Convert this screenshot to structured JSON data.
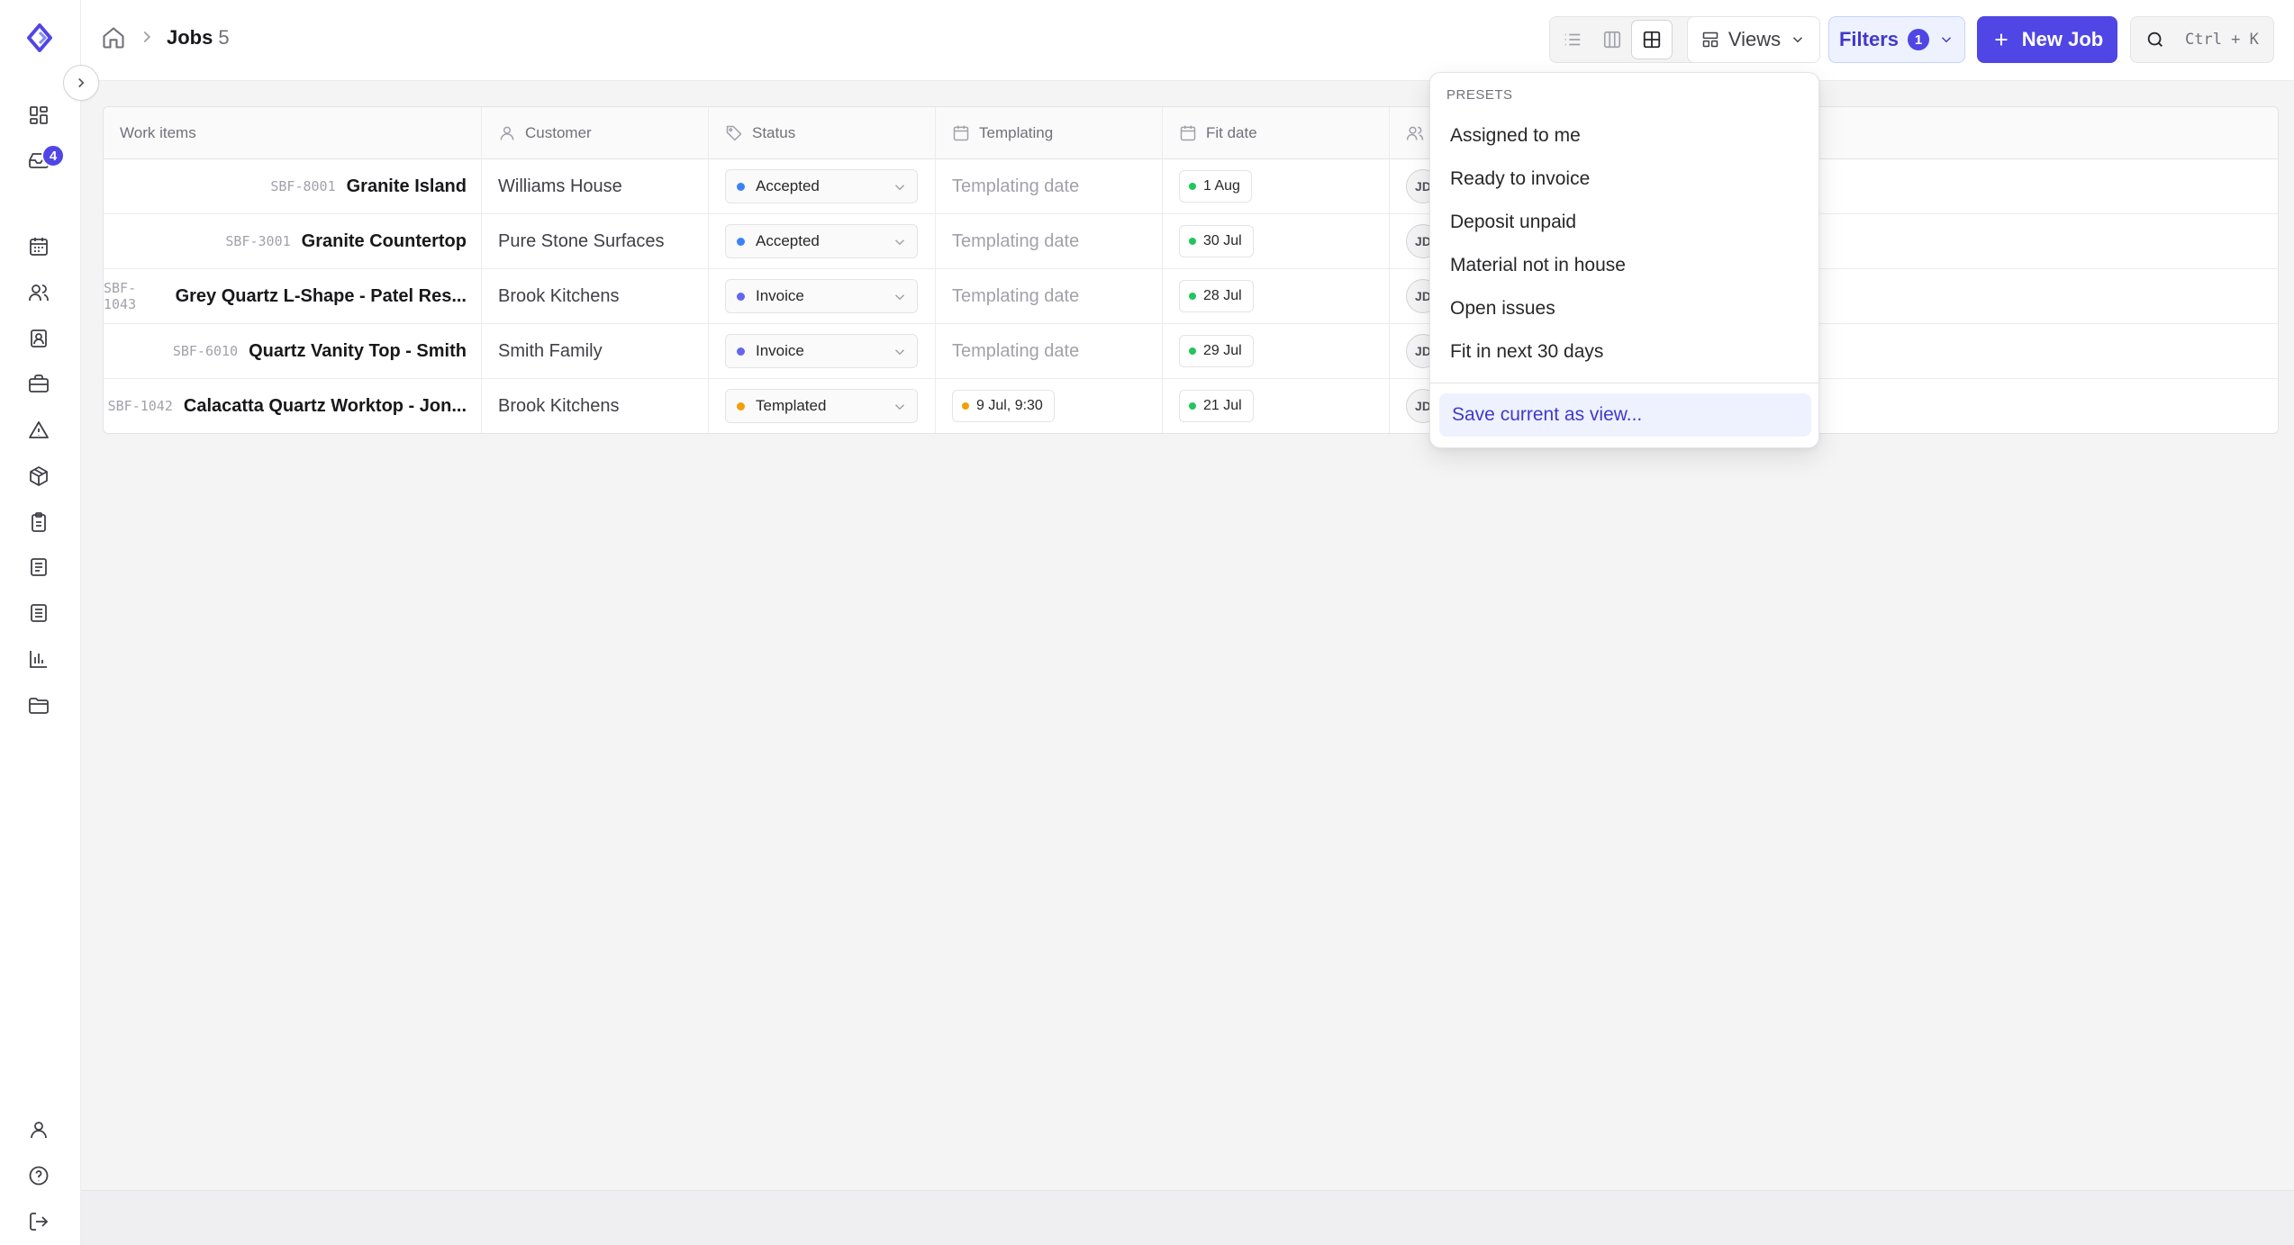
{
  "header": {
    "title": "Jobs",
    "count": "5",
    "views_label": "Views",
    "filters_label": "Filters",
    "filters_count": "1",
    "new_job_label": "New Job",
    "search_shortcut": "Ctrl + K"
  },
  "sidebar": {
    "inbox_badge": "4",
    "items": [
      "dashboard-icon",
      "inbox-icon",
      "calendar-icon",
      "users-icon",
      "contacts-icon",
      "briefcase-icon",
      "warning-icon",
      "package-icon",
      "clipboard-icon",
      "document-icon",
      "invoice-icon",
      "chart-icon",
      "folder-icon"
    ],
    "bottom_items": [
      "user-icon",
      "help-icon",
      "logout-icon"
    ]
  },
  "table": {
    "columns": {
      "work_items": "Work items",
      "customer": "Customer",
      "status": "Status",
      "templating": "Templating",
      "fit_date": "Fit date"
    },
    "rows": [
      {
        "code": "SBF-8001",
        "title": "Granite Island",
        "customer": "Williams House",
        "status": "Accepted",
        "status_color": "#3b82f6",
        "templating": "Templating date",
        "templating_set": false,
        "fit_date": "1 Aug",
        "assignee": "JD"
      },
      {
        "code": "SBF-3001",
        "title": "Granite Countertop",
        "customer": "Pure Stone Surfaces",
        "status": "Accepted",
        "status_color": "#3b82f6",
        "templating": "Templating date",
        "templating_set": false,
        "fit_date": "30 Jul",
        "assignee": "JD"
      },
      {
        "code": "SBF-1043",
        "title": "Grey Quartz L-Shape - Patel Res...",
        "customer": "Brook Kitchens",
        "status": "Invoice",
        "status_color": "#6366f1",
        "templating": "Templating date",
        "templating_set": false,
        "fit_date": "28 Jul",
        "assignee": "JD"
      },
      {
        "code": "SBF-6010",
        "title": "Quartz Vanity Top - Smith",
        "customer": "Smith Family",
        "status": "Invoice",
        "status_color": "#6366f1",
        "templating": "Templating date",
        "templating_set": false,
        "fit_date": "29 Jul",
        "assignee": "JD"
      },
      {
        "code": "SBF-1042",
        "title": "Calacatta Quartz Worktop - Jon...",
        "customer": "Brook Kitchens",
        "status": "Templated",
        "status_color": "#f59e0b",
        "templating": "9 Jul, 9:30",
        "templating_set": true,
        "fit_date": "21 Jul",
        "assignee": "JD"
      }
    ]
  },
  "presets_menu": {
    "heading": "PRESETS",
    "items": [
      "Assigned to me",
      "Ready to invoice",
      "Deposit unpaid",
      "Material not in house",
      "Open issues",
      "Fit in next 30 days"
    ],
    "save_label": "Save current as view..."
  },
  "colors": {
    "accent": "#4f46e5",
    "date_dot": "#22c55e",
    "templated_dot": "#f59e0b"
  }
}
